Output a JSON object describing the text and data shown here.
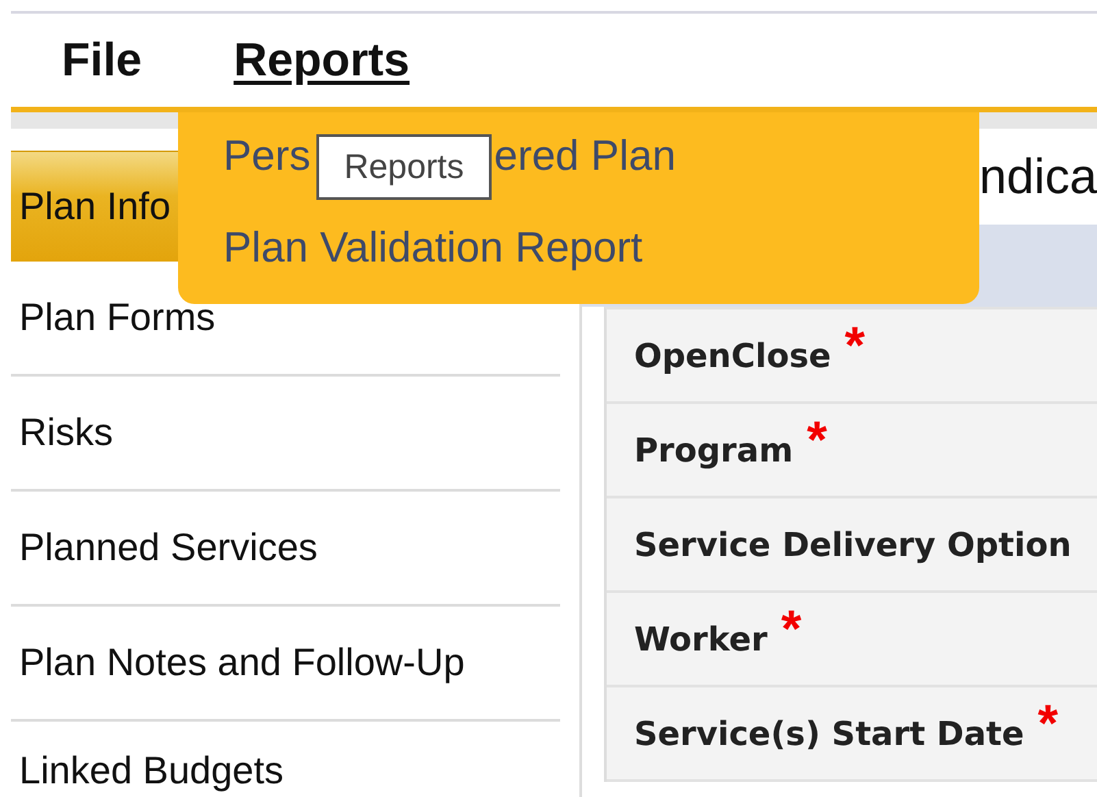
{
  "menu_bar": [
    {
      "label": "File",
      "selected": false
    },
    {
      "label": "Reports",
      "selected": true
    }
  ],
  "dropdown": {
    "items": [
      {
        "label_start": "Pers",
        "label_end": "ered Plan"
      },
      {
        "label": "Plan Validation Report"
      }
    ]
  },
  "tooltip": "Reports",
  "sidebar": {
    "items": [
      {
        "label": "Plan Info",
        "selected": true
      },
      {
        "label": "Plan Forms",
        "selected": false
      },
      {
        "label": "Risks",
        "selected": false
      },
      {
        "label": "Planned Services",
        "selected": false
      },
      {
        "label": "Plan Notes and Follow-Up",
        "selected": false
      },
      {
        "label": "Linked Budgets",
        "selected": false
      }
    ]
  },
  "panel": {
    "heading": "ndica"
  },
  "form": {
    "required_mark": "*",
    "fields": [
      {
        "label": "OpenClose",
        "required": true
      },
      {
        "label": "Program",
        "required": true
      },
      {
        "label": "Service Delivery Option",
        "required": false
      },
      {
        "label": "Worker",
        "required": true
      },
      {
        "label": "Service(s) Start Date",
        "required": true
      }
    ]
  }
}
